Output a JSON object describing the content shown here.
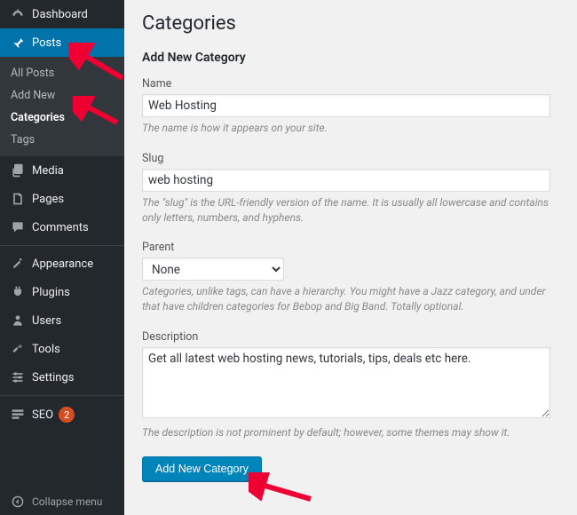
{
  "sidebar": {
    "items": [
      {
        "label": "Dashboard",
        "icon": "dashboard"
      },
      {
        "label": "Posts",
        "icon": "pin",
        "active": true
      },
      {
        "label": "Media",
        "icon": "media"
      },
      {
        "label": "Pages",
        "icon": "pages"
      },
      {
        "label": "Comments",
        "icon": "comments"
      },
      {
        "label": "Appearance",
        "icon": "appearance"
      },
      {
        "label": "Plugins",
        "icon": "plugins"
      },
      {
        "label": "Users",
        "icon": "users"
      },
      {
        "label": "Tools",
        "icon": "tools"
      },
      {
        "label": "Settings",
        "icon": "settings"
      },
      {
        "label": "SEO",
        "icon": "seo",
        "badge": "2"
      }
    ],
    "submenu": [
      {
        "label": "All Posts"
      },
      {
        "label": "Add New"
      },
      {
        "label": "Categories",
        "current": true
      },
      {
        "label": "Tags"
      }
    ],
    "collapse_label": "Collapse menu"
  },
  "page": {
    "title": "Categories",
    "section_heading": "Add New Category",
    "name_label": "Name",
    "name_value": "Web Hosting",
    "name_help": "The name is how it appears on your site.",
    "slug_label": "Slug",
    "slug_value": "web hosting",
    "slug_help": "The \"slug\" is the URL-friendly version of the name. It is usually all lowercase and contains only letters, numbers, and hyphens.",
    "parent_label": "Parent",
    "parent_value": "None",
    "parent_help": "Categories, unlike tags, can have a hierarchy. You might have a Jazz category, and under that have children categories for Bebop and Big Band. Totally optional.",
    "description_label": "Description",
    "description_value": "Get all latest web hosting news, tutorials, tips, deals etc here.",
    "description_help": "The description is not prominent by default; however, some themes may show it.",
    "submit_label": "Add New Category"
  }
}
